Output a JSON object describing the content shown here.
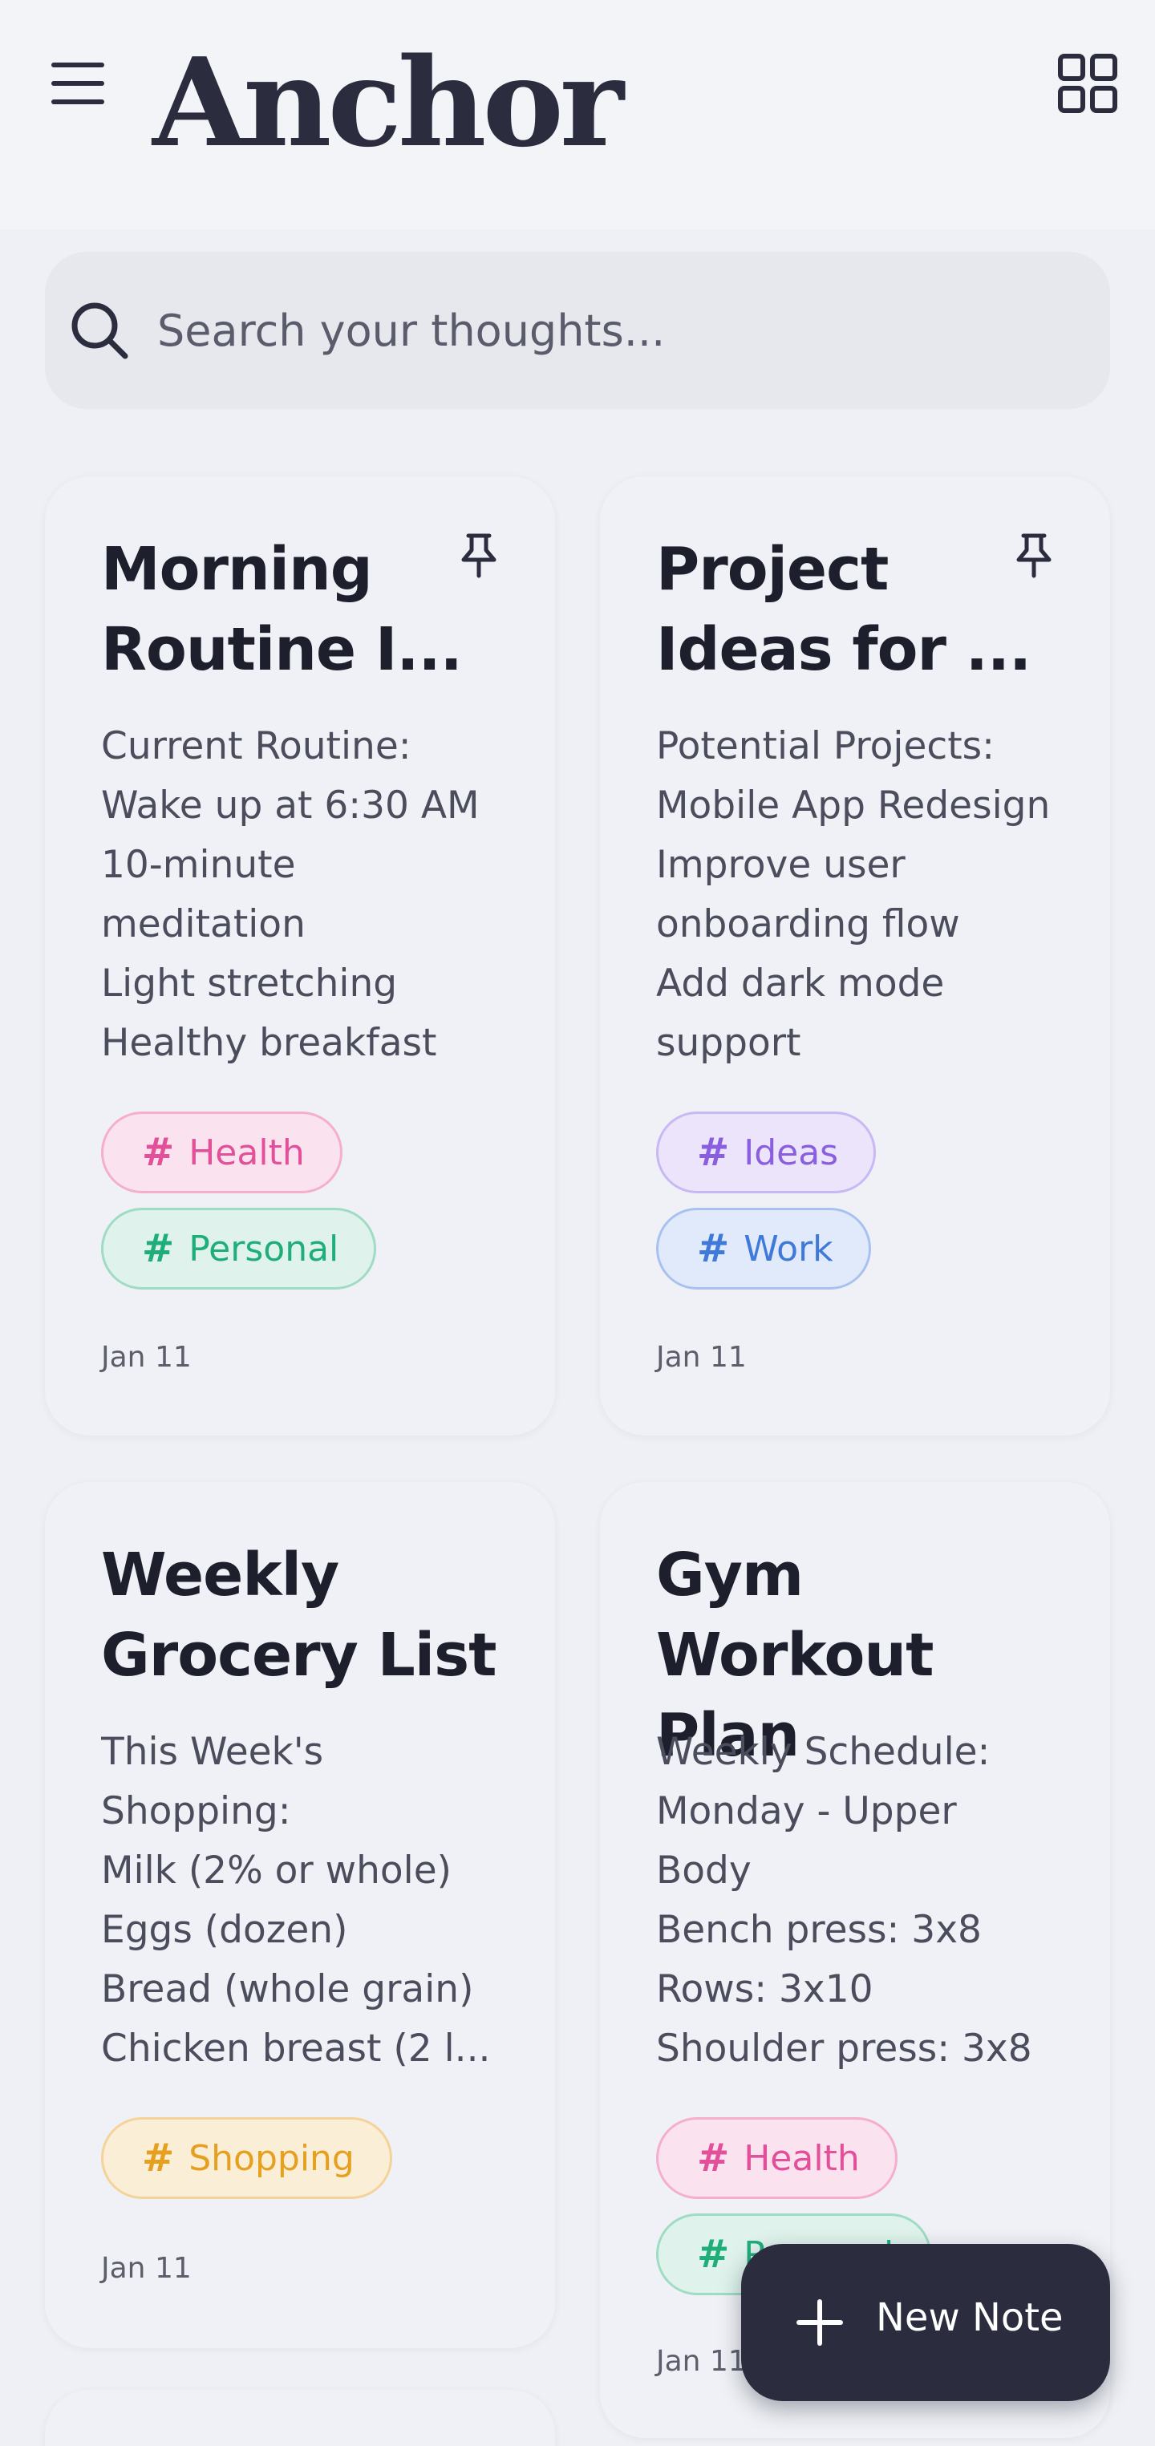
{
  "header": {
    "title": "Anchor",
    "menu_icon": "hamburger-menu-icon",
    "layout_icon": "grid-view-icon"
  },
  "search": {
    "placeholder": "Search your thoughts..."
  },
  "notes": [
    {
      "title_lines": [
        "Morning",
        "Routine I..."
      ],
      "pinned": true,
      "body": [
        "Current Routine:",
        "Wake up at 6:30 AM",
        "10-minute",
        "meditation",
        "Light stretching",
        "Healthy breakfast"
      ],
      "tags": [
        "Health",
        "Personal"
      ],
      "date": "Jan 11"
    },
    {
      "title_lines": [
        "Project",
        "Ideas for ..."
      ],
      "pinned": true,
      "body": [
        "Potential Projects:",
        "Mobile App Redesign",
        "Improve user",
        "onboarding flow",
        "Add dark mode",
        "support"
      ],
      "tags": [
        "Ideas",
        "Work"
      ],
      "date": "Jan 11"
    },
    {
      "title_lines": [
        "Weekly",
        "Grocery List"
      ],
      "pinned": false,
      "body": [
        "This Week's",
        "Shopping:",
        "Milk (2% or whole)",
        "Eggs (dozen)",
        "Bread (whole grain)",
        "Chicken breast (2 l..."
      ],
      "tags": [
        "Shopping"
      ],
      "date": "Jan 11"
    },
    {
      "title_lines": [
        "Gym",
        "Workout Plan"
      ],
      "pinned": false,
      "body": [
        "Weekly Schedule:",
        "Monday - Upper",
        "Body",
        "Bench press: 3x8",
        "Rows: 3x10",
        "Shoulder press: 3x8"
      ],
      "tags": [
        "Health",
        "Personal"
      ],
      "date": "Jan 11"
    }
  ],
  "tag_hash": "#",
  "fab": {
    "label": "New Note",
    "icon": "plus-icon"
  },
  "colors": {
    "primary_dark": "#2b2d3e",
    "background": "#eef0f5",
    "tag_health": "#e3509a",
    "tag_personal": "#1fae7a",
    "tag_ideas": "#8a5fdf",
    "tag_work": "#3f79d9",
    "tag_shopping": "#e6a020"
  }
}
